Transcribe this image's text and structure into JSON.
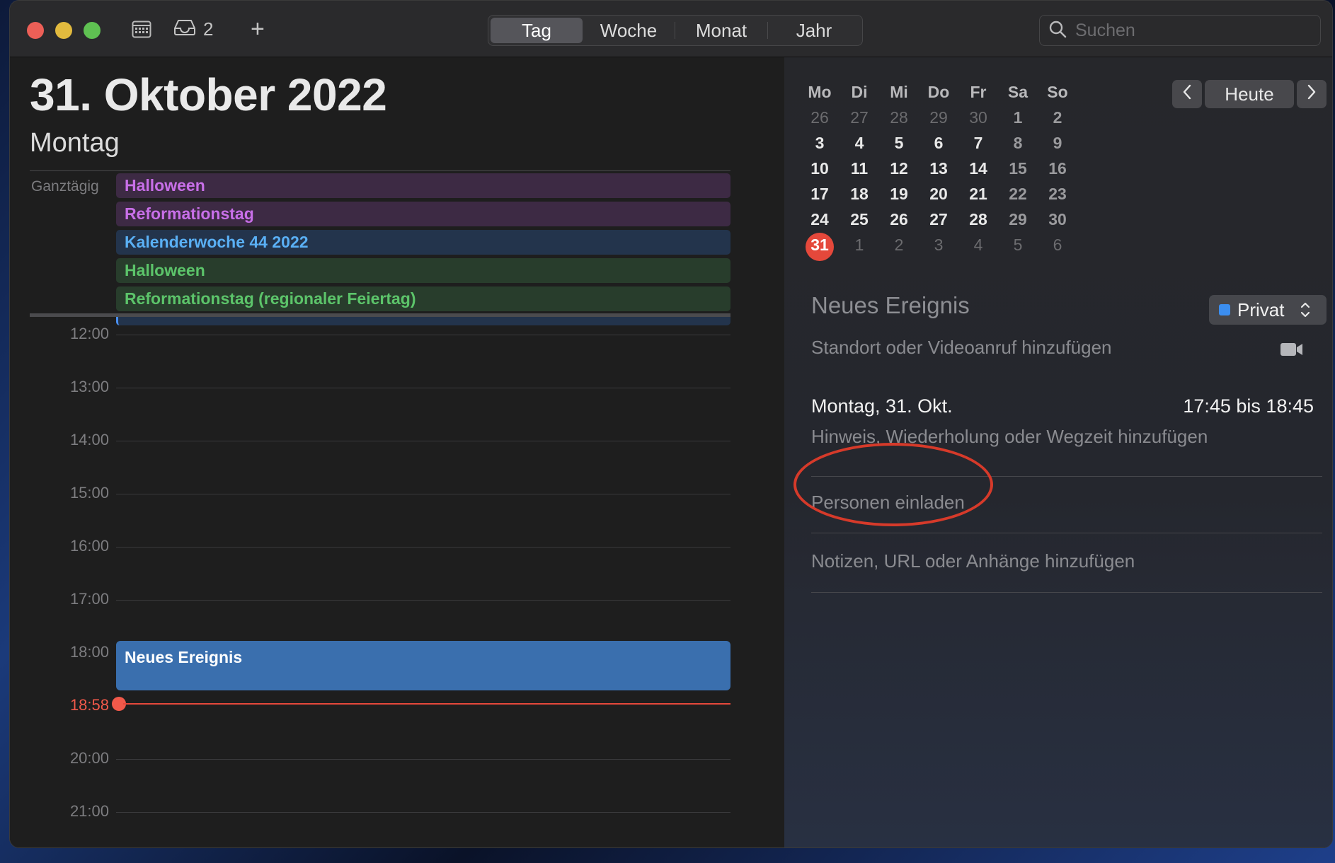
{
  "toolbar": {
    "inbox_count": "2",
    "tabs": [
      "Tag",
      "Woche",
      "Monat",
      "Jahr"
    ],
    "active_tab": "Tag",
    "search_placeholder": "Suchen"
  },
  "day": {
    "date_title": "31. Oktober 2022",
    "weekday": "Montag",
    "allday_label": "Ganztägig",
    "allday_events": [
      {
        "title": "Halloween",
        "calendar_color": "#c86fe8"
      },
      {
        "title": "Reformationstag",
        "calendar_color": "#c86fe8"
      },
      {
        "title": "Kalenderwoche 44 2022",
        "calendar_color": "#5ab0f5"
      },
      {
        "title": "Halloween",
        "calendar_color": "#5cc46a"
      },
      {
        "title": "Reformationstag (regionaler Feiertag)",
        "calendar_color": "#5cc46a"
      }
    ],
    "hours": [
      "12:00",
      "13:00",
      "14:00",
      "15:00",
      "16:00",
      "17:00",
      "18:00",
      "20:00",
      "21:00"
    ],
    "now_time": "18:58",
    "timed_event": {
      "title": "Neues Ereignis"
    }
  },
  "mini_calendar": {
    "weekday_headers": [
      "Mo",
      "Di",
      "Mi",
      "Do",
      "Fr",
      "Sa",
      "So"
    ],
    "weeks": [
      [
        "26",
        "27",
        "28",
        "29",
        "30",
        "1",
        "2"
      ],
      [
        "3",
        "4",
        "5",
        "6",
        "7",
        "8",
        "9"
      ],
      [
        "10",
        "11",
        "12",
        "13",
        "14",
        "15",
        "16"
      ],
      [
        "17",
        "18",
        "19",
        "20",
        "21",
        "22",
        "23"
      ],
      [
        "24",
        "25",
        "26",
        "27",
        "28",
        "29",
        "30"
      ],
      [
        "31",
        "1",
        "2",
        "3",
        "4",
        "5",
        "6"
      ]
    ],
    "today": "31",
    "today_label": "Heute"
  },
  "editor": {
    "title": "Neues Ereignis",
    "calendar_name": "Privat",
    "calendar_color": "#3b8ef0",
    "location_placeholder": "Standort oder Videoanruf hinzufügen",
    "date": "Montag, 31. Okt.",
    "time_range": "17:45 bis 18:45",
    "alert_placeholder": "Hinweis, Wiederholung oder Wegzeit hinzufügen",
    "invite_placeholder": "Personen einladen",
    "notes_placeholder": "Notizen, URL oder Anhänge hinzufügen"
  },
  "icons": {
    "window_close": "close-icon",
    "window_minimize": "minimize-icon",
    "window_maximize": "maximize-icon",
    "calendar_list": "calendar-icon",
    "inbox": "inbox-icon",
    "add_event": "plus-icon",
    "search": "search-icon",
    "previous": "chevron-left-icon",
    "next": "chevron-right-icon",
    "video_call": "video-camera-icon",
    "calendar_popup": "updown-chevron-icon"
  },
  "colors": {
    "accent": "#3b8ef0",
    "current_time": "#e5483b",
    "annotation": "#d63a2a"
  }
}
